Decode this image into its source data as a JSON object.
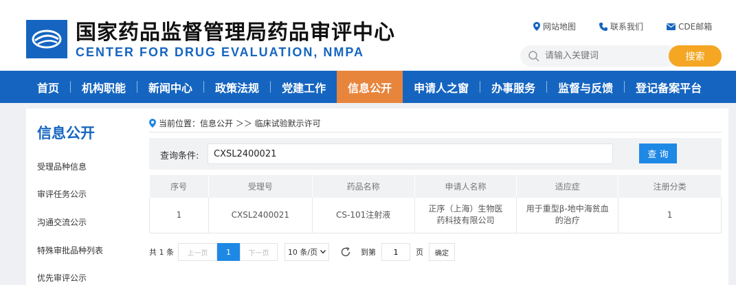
{
  "header": {
    "title_cn": "国家药品监督管理局药品审评中心",
    "title_en": "CENTER FOR DRUG EVALUATION, NMPA",
    "links": [
      {
        "label": "网站地图",
        "icon": "location-pin-icon"
      },
      {
        "label": "联系我们",
        "icon": "phone-icon"
      },
      {
        "label": "CDE邮箱",
        "icon": "mail-icon"
      }
    ],
    "search_placeholder": "请输入关键词",
    "search_button": "搜索"
  },
  "nav": {
    "items": [
      "首页",
      "机构职能",
      "新闻中心",
      "政策法规",
      "党建工作",
      "信息公开",
      "申请人之窗",
      "办事服务",
      "监督与反馈",
      "登记备案平台"
    ],
    "active": "信息公开"
  },
  "sidebar": {
    "title": "信息公开",
    "items": [
      "受理品种信息",
      "审评任务公示",
      "沟通交流公示",
      "特殊审批品种列表",
      "优先审评公示"
    ]
  },
  "breadcrumb": {
    "text": "当前位置：信息公开 ＞＞ 临床试验默示许可"
  },
  "query": {
    "label": "查询条件:",
    "value": "CXSL2400021",
    "button": "查 询"
  },
  "table": {
    "headers": [
      "序号",
      "受理号",
      "药品名称",
      "申请人名称",
      "适应症",
      "注册分类"
    ],
    "rows": [
      [
        "1",
        "CXSL2400021",
        "CS-101注射液",
        "正序（上海）生物医药科技有限公司",
        "用于重型β-地中海贫血的治疗",
        "1"
      ]
    ]
  },
  "pager": {
    "total": "共 1 条",
    "prev": "上一页",
    "current": "1",
    "next": "下一页",
    "page_size": "10 条/页",
    "goto_label": "到第",
    "goto_value": "1",
    "page_unit": "页",
    "confirm": "确定"
  },
  "colors": {
    "primary": "#1565c0",
    "accent": "#e8853c",
    "search_button": "#f5a623"
  }
}
